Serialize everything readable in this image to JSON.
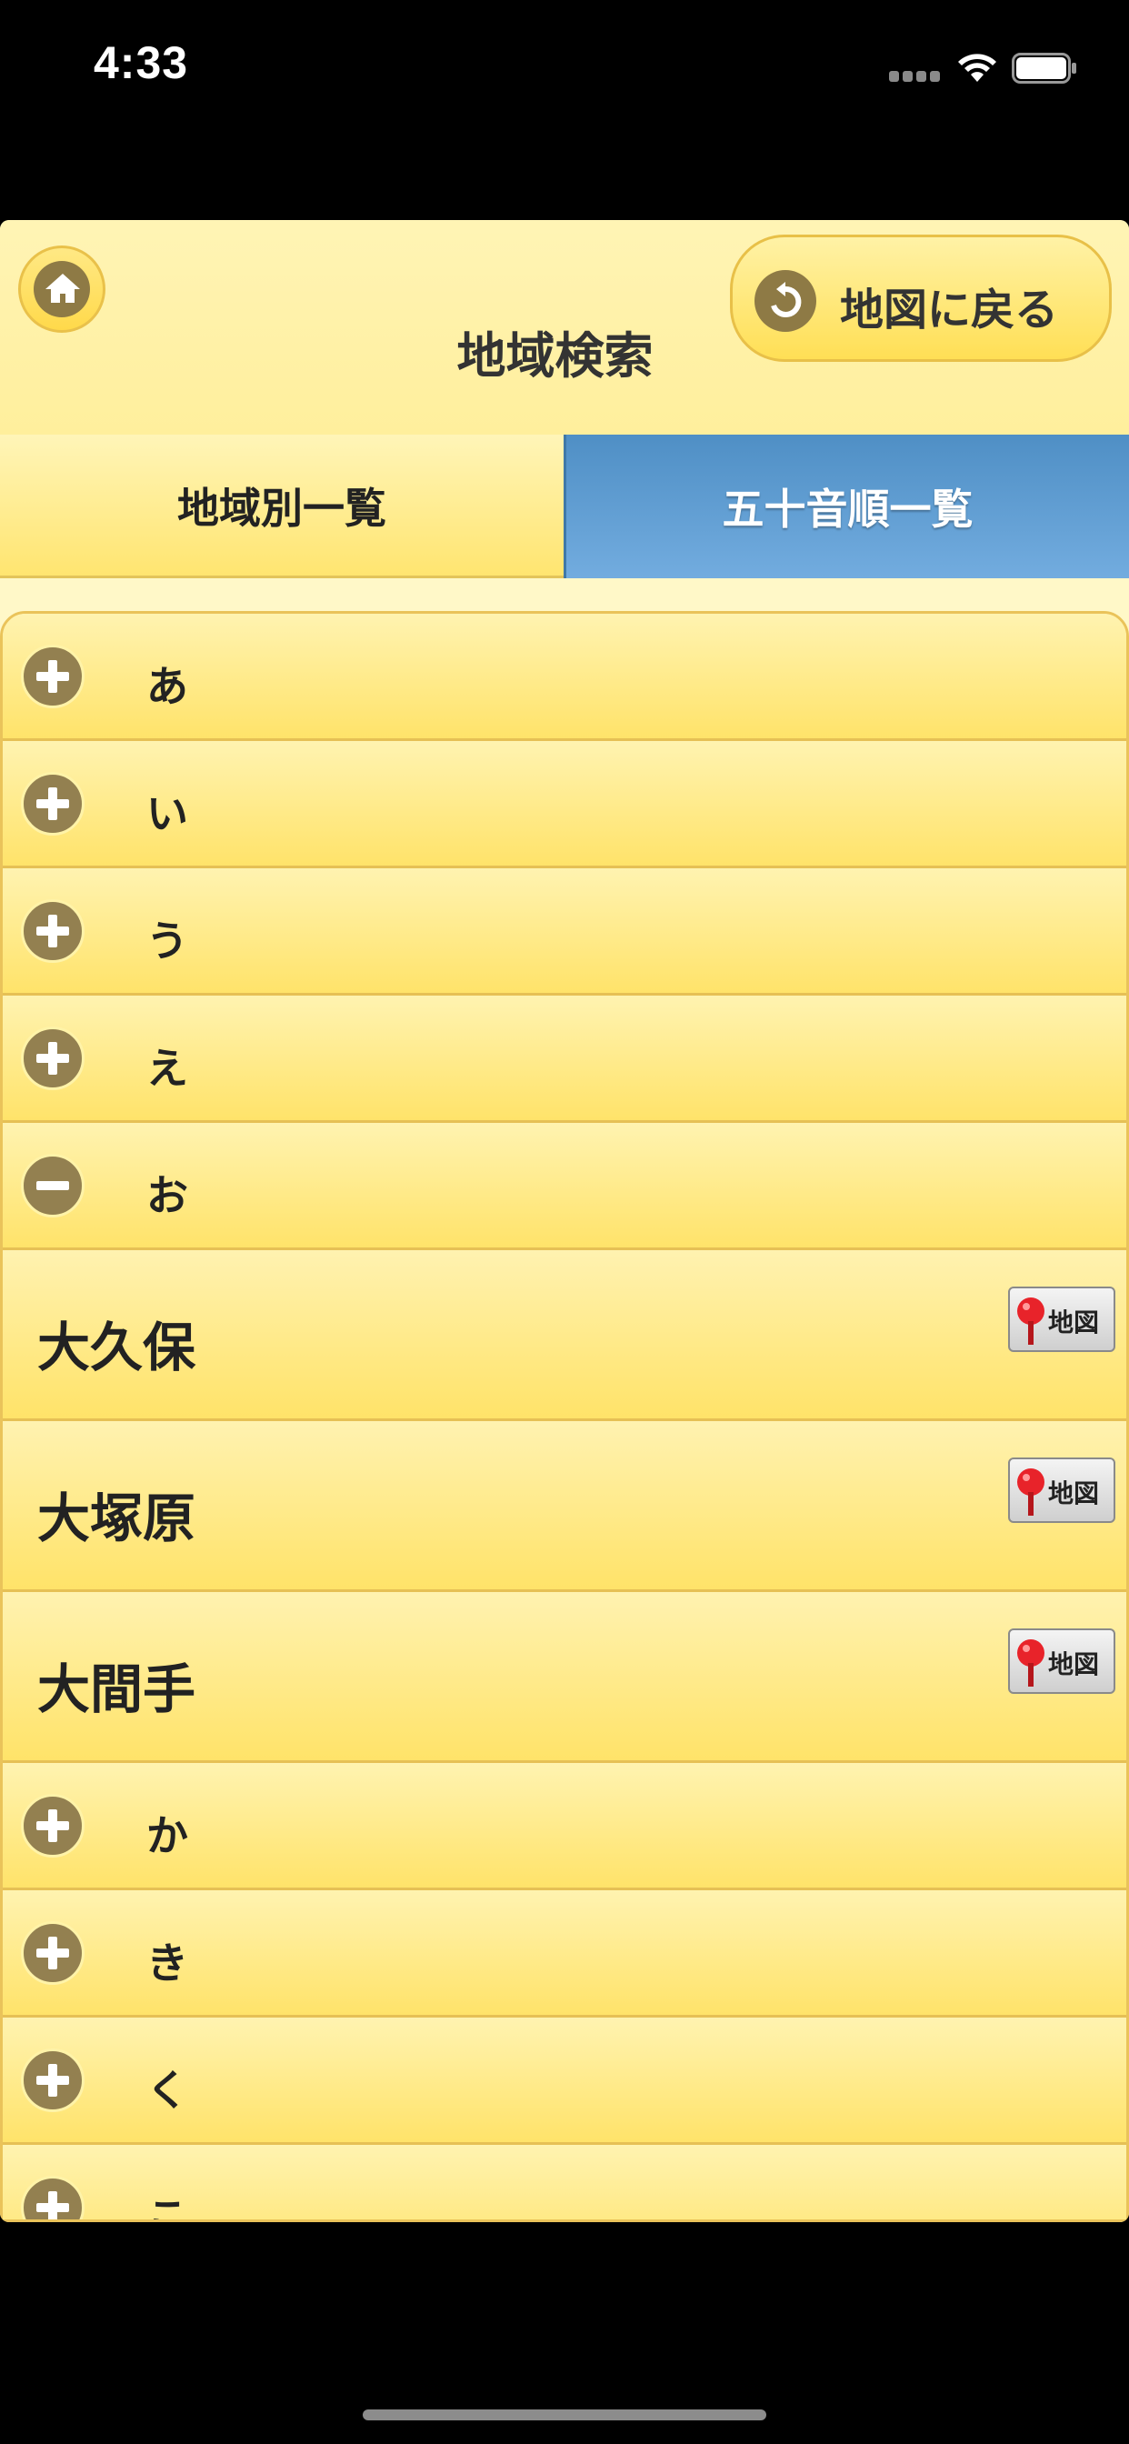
{
  "status_bar": {
    "time": "4:33"
  },
  "header": {
    "title": "地域検索",
    "back_label": "地図に戻る"
  },
  "tabs": [
    {
      "label": "地域別一覧",
      "selected": false
    },
    {
      "label": "五十音順一覧",
      "selected": true
    }
  ],
  "list": {
    "kana_before": [
      {
        "label": "あ",
        "icon": "plus-icon"
      },
      {
        "label": "い",
        "icon": "plus-icon"
      },
      {
        "label": "う",
        "icon": "plus-icon"
      },
      {
        "label": "え",
        "icon": "plus-icon"
      },
      {
        "label": "お",
        "icon": "minus-icon",
        "expanded": true
      }
    ],
    "places": [
      {
        "name": "大久保",
        "map_label": "地図"
      },
      {
        "name": "大塚原",
        "map_label": "地図"
      },
      {
        "name": "大間手",
        "map_label": "地図"
      }
    ],
    "kana_after": [
      {
        "label": "か",
        "icon": "plus-icon"
      },
      {
        "label": "き",
        "icon": "plus-icon"
      },
      {
        "label": "く",
        "icon": "plus-icon"
      },
      {
        "label": "こ",
        "icon": "plus-icon"
      }
    ]
  },
  "colors": {
    "accent_blue": "#5a98cf",
    "row_yellow": "#ffe36a",
    "icon_brown": "#938050"
  }
}
